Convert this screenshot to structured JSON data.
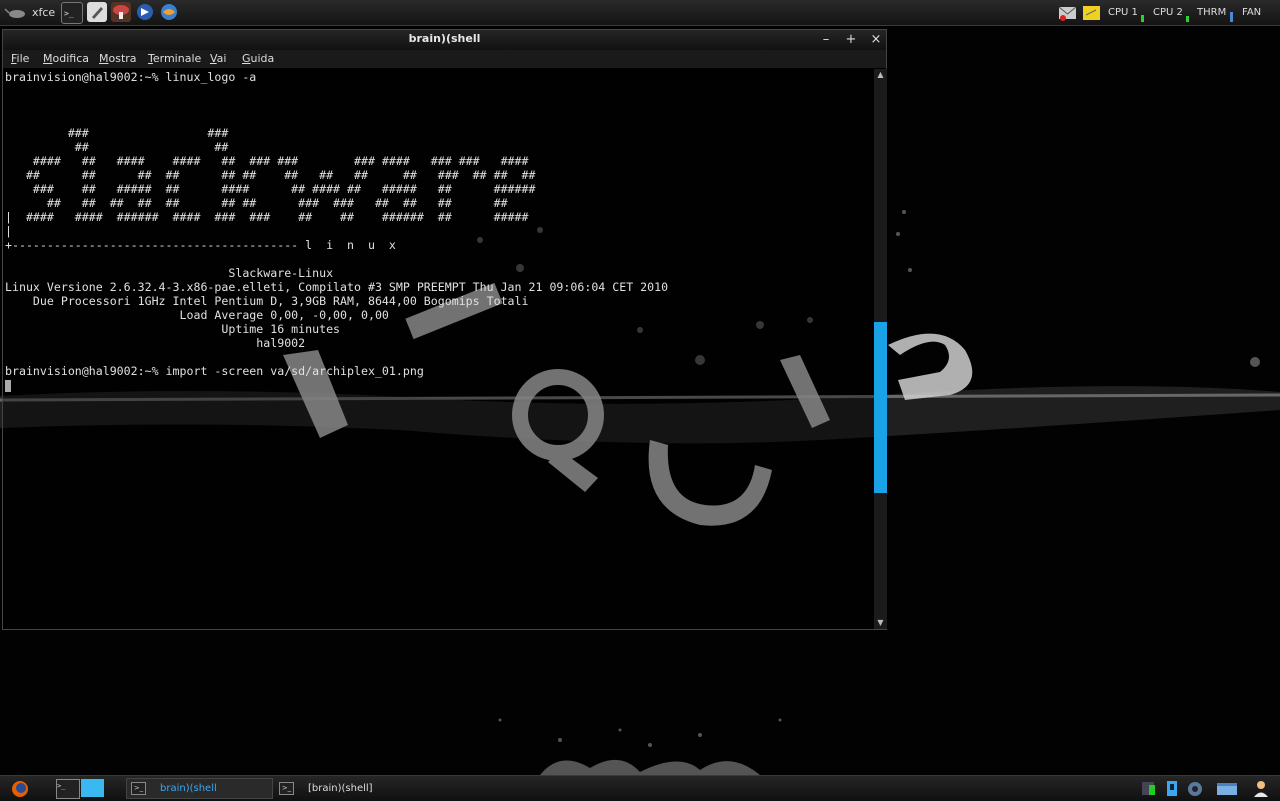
{
  "top_panel": {
    "menu_label": "xfce",
    "launchers": [
      "terminal-icon",
      "text-editor-icon",
      "mushroom-app-icon",
      "browser-icon",
      "thunderbird-icon"
    ],
    "tray_icons": [
      "mail-icon",
      "notes-icon"
    ],
    "monitors": [
      {
        "label": "CPU 1",
        "level": 0.5
      },
      {
        "label": "CPU 2",
        "level": 0.4
      },
      {
        "label": "THRM",
        "level": 0.7
      },
      {
        "label": "FAN",
        "level": 0.0
      }
    ]
  },
  "window": {
    "title": "brain)(shell",
    "menu": [
      {
        "label": "File",
        "u": "F",
        "rest": "ile"
      },
      {
        "label": "Modifica",
        "u": "M",
        "rest": "odifica"
      },
      {
        "label": "Mostra",
        "u": "M",
        "rest": "ostra"
      },
      {
        "label": "Terminale",
        "u": "T",
        "rest": "erminale"
      },
      {
        "label": "Vai",
        "u": "V",
        "rest": "ai"
      },
      {
        "label": "Guida",
        "u": "G",
        "rest": "uida"
      }
    ],
    "buttons": {
      "minimize": "–",
      "maximize": "+",
      "close": "×"
    },
    "scroll": {
      "up": "▲",
      "down": "▼",
      "position": 0.66,
      "visible_fraction": 0.32
    }
  },
  "terminal": {
    "lines": [
      "brainvision@hal9002:~% linux_logo -a",
      "",
      "",
      "",
      "         ###                 ###",
      "          ##                  ##",
      "    ####   ##   ####    ####   ##  ### ###        ### ####   ### ###   ####",
      "   ##      ##      ##  ##      ## ##    ##   ##   ##     ##   ###  ## ##  ##",
      "    ###    ##   #####  ##      ####      ## #### ##   #####   ##      ######",
      "      ##   ##  ##  ##  ##      ## ##      ###  ###   ##  ##   ##      ##",
      "|  ####   ####  ######  ####  ###  ###    ##    ##    ######  ##      #####",
      "|",
      "+----------------------------------------- l  i  n  u  x",
      "",
      "                                Slackware-Linux",
      "Linux Versione 2.6.32.4-3.x86-pae.elleti, Compilato #3 SMP PREEMPT Thu Jan 21 09:06:04 CET 2010",
      "    Due Processori 1GHz Intel Pentium D, 3,9GB RAM, 8644,00 Bogomips Totali",
      "                         Load Average 0,00, -0,00, 0,00",
      "                               Uptime 16 minutes",
      "                                    hal9002",
      "",
      "brainvision@hal9002:~% import -screen va/sd/archiplex_01.png",
      ""
    ]
  },
  "bottom_panel": {
    "tasks": [
      {
        "label": "brain)(shell",
        "active": true
      },
      {
        "label": "[brain)(shell]",
        "active": false
      }
    ],
    "tray_icons": [
      "network-icon",
      "usb-icon",
      "settings-icon",
      "desktop-icon",
      "user-icon"
    ]
  },
  "colors": {
    "accent": "#19a3e6",
    "monitor_bar": "#2fd12f",
    "background": "#000000"
  }
}
